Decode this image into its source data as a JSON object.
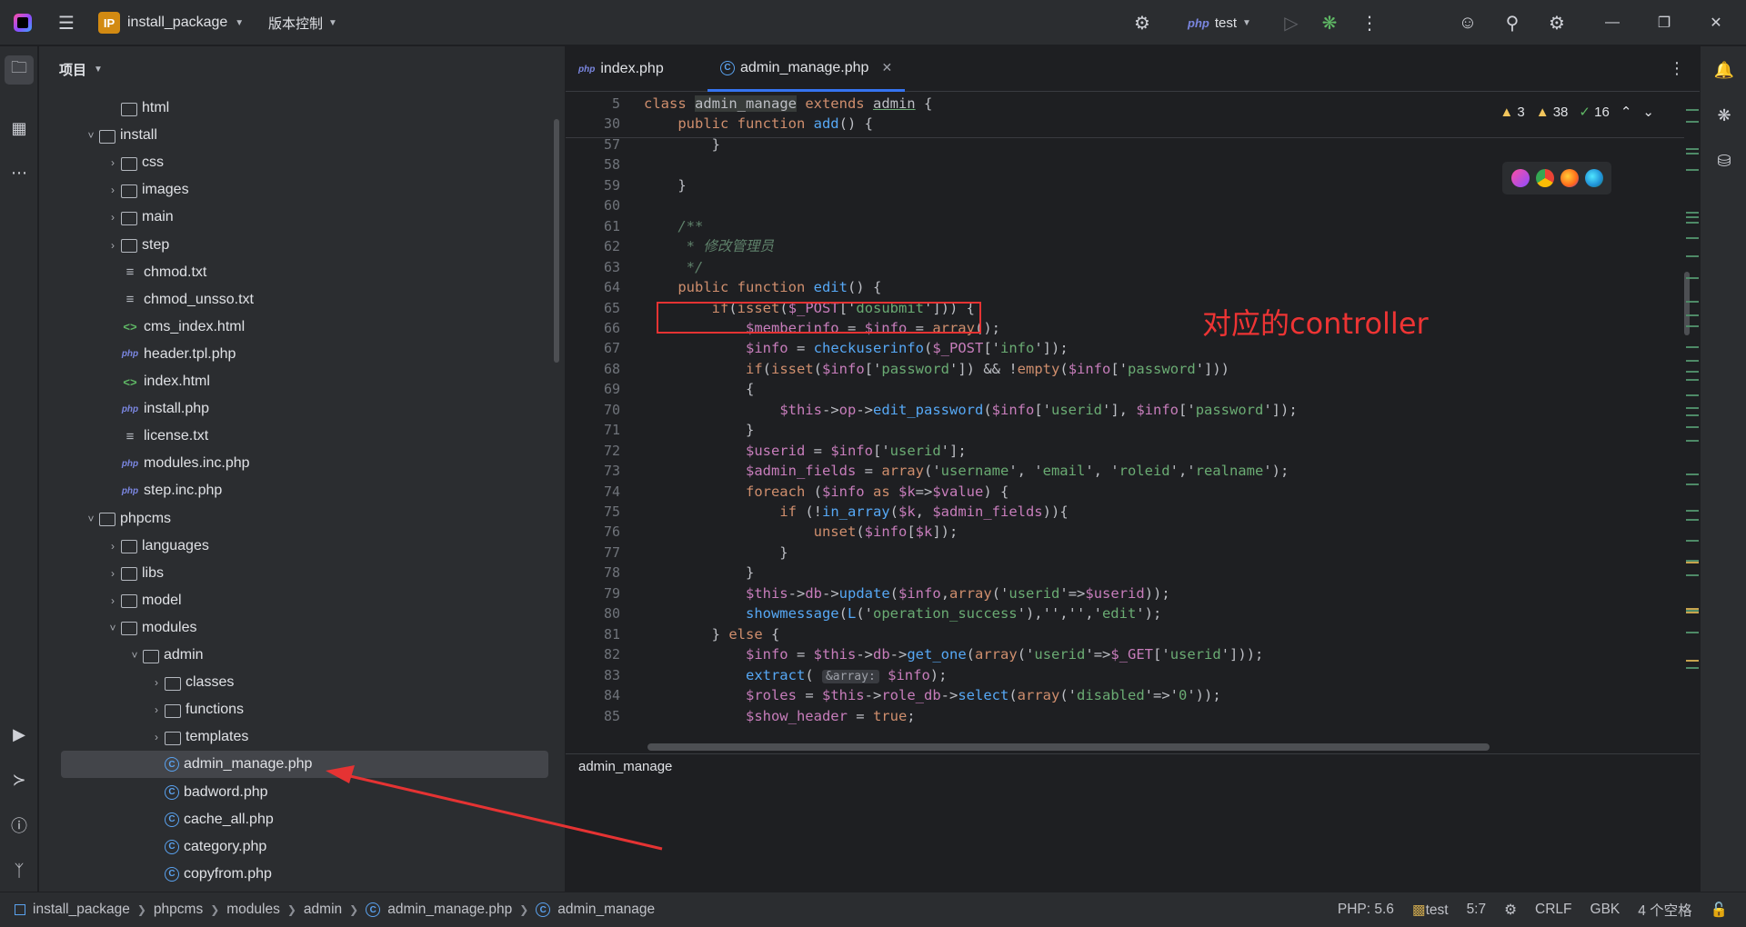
{
  "titlebar": {
    "project_badge": "IP",
    "project_name": "install_package",
    "vcs_label": "版本控制",
    "run_config_lang": "php",
    "run_config": "test"
  },
  "project_panel": {
    "title": "项目"
  },
  "tree": [
    {
      "depth": 2,
      "type": "folder",
      "label": "html",
      "expand": ""
    },
    {
      "depth": 1,
      "type": "folder",
      "label": "install",
      "expand": "open"
    },
    {
      "depth": 2,
      "type": "folder",
      "label": "css",
      "expand": "closed"
    },
    {
      "depth": 2,
      "type": "folder",
      "label": "images",
      "expand": "closed"
    },
    {
      "depth": 2,
      "type": "folder",
      "label": "main",
      "expand": "closed"
    },
    {
      "depth": 2,
      "type": "folder",
      "label": "step",
      "expand": "closed"
    },
    {
      "depth": 2,
      "type": "txt",
      "label": "chmod.txt",
      "expand": ""
    },
    {
      "depth": 2,
      "type": "txt",
      "label": "chmod_unsso.txt",
      "expand": ""
    },
    {
      "depth": 2,
      "type": "html",
      "label": "cms_index.html",
      "expand": ""
    },
    {
      "depth": 2,
      "type": "php",
      "label": "header.tpl.php",
      "expand": ""
    },
    {
      "depth": 2,
      "type": "html",
      "label": "index.html",
      "expand": ""
    },
    {
      "depth": 2,
      "type": "php",
      "label": "install.php",
      "expand": ""
    },
    {
      "depth": 2,
      "type": "txt",
      "label": "license.txt",
      "expand": ""
    },
    {
      "depth": 2,
      "type": "php",
      "label": "modules.inc.php",
      "expand": ""
    },
    {
      "depth": 2,
      "type": "php",
      "label": "step.inc.php",
      "expand": ""
    },
    {
      "depth": 1,
      "type": "folder",
      "label": "phpcms",
      "expand": "open"
    },
    {
      "depth": 2,
      "type": "folder",
      "label": "languages",
      "expand": "closed"
    },
    {
      "depth": 2,
      "type": "folder",
      "label": "libs",
      "expand": "closed"
    },
    {
      "depth": 2,
      "type": "folder",
      "label": "model",
      "expand": "closed"
    },
    {
      "depth": 2,
      "type": "folder",
      "label": "modules",
      "expand": "open"
    },
    {
      "depth": 3,
      "type": "folder",
      "label": "admin",
      "expand": "open"
    },
    {
      "depth": 4,
      "type": "folder",
      "label": "classes",
      "expand": "closed"
    },
    {
      "depth": 4,
      "type": "folder",
      "label": "functions",
      "expand": "closed"
    },
    {
      "depth": 4,
      "type": "folder",
      "label": "templates",
      "expand": "closed"
    },
    {
      "depth": 4,
      "type": "class",
      "label": "admin_manage.php",
      "expand": "",
      "selected": true
    },
    {
      "depth": 4,
      "type": "class",
      "label": "badword.php",
      "expand": ""
    },
    {
      "depth": 4,
      "type": "class",
      "label": "cache_all.php",
      "expand": ""
    },
    {
      "depth": 4,
      "type": "class",
      "label": "category.php",
      "expand": ""
    },
    {
      "depth": 4,
      "type": "class",
      "label": "copyfrom.php",
      "expand": ""
    }
  ],
  "tabs": [
    {
      "label": "index.php",
      "icon": "php",
      "active": false
    },
    {
      "label": "admin_manage.php",
      "icon": "class",
      "active": true
    }
  ],
  "inspection": {
    "warnings_a": "3",
    "warnings_b": "38",
    "ok": "16"
  },
  "browsers": [
    "phpstorm-icon",
    "chrome-icon",
    "firefox-icon",
    "edge-icon"
  ],
  "code_lines": [
    {
      "n": "5",
      "h": [
        [
          "kw",
          "class "
        ],
        [
          "hl",
          "admin_manage"
        ],
        [
          "kw",
          " extends "
        ],
        [
          "und",
          "admin"
        ],
        [
          "",
          " {"
        ]
      ]
    },
    {
      "n": "30",
      "h": [
        [
          "",
          "    "
        ],
        [
          "kw",
          "public function "
        ],
        [
          "fn",
          "add"
        ],
        [
          "",
          "() {"
        ]
      ]
    },
    {
      "n": "57",
      "h": [
        [
          "",
          "        }"
        ]
      ]
    },
    {
      "n": "58",
      "h": [
        [
          "",
          ""
        ]
      ]
    },
    {
      "n": "59",
      "h": [
        [
          "",
          "    }"
        ]
      ]
    },
    {
      "n": "60",
      "h": [
        [
          "",
          ""
        ]
      ]
    },
    {
      "n": "61",
      "h": [
        [
          "",
          "    "
        ],
        [
          "doc",
          "/**"
        ]
      ]
    },
    {
      "n": "62",
      "h": [
        [
          "",
          "     "
        ],
        [
          "doc",
          "* 修改管理员"
        ]
      ]
    },
    {
      "n": "63",
      "h": [
        [
          "",
          "     "
        ],
        [
          "doc",
          "*/"
        ]
      ]
    },
    {
      "n": "64",
      "h": [
        [
          "",
          "    "
        ],
        [
          "kw",
          "public function "
        ],
        [
          "fn",
          "edit"
        ],
        [
          "",
          "() {"
        ]
      ]
    },
    {
      "n": "65",
      "h": [
        [
          "",
          "        "
        ],
        [
          "kw",
          "if"
        ],
        [
          "",
          "("
        ],
        [
          "kw",
          "isset"
        ],
        [
          "",
          "("
        ],
        [
          "var",
          "$_POST"
        ],
        [
          "",
          "['"
        ],
        [
          "str",
          "dosubmit"
        ],
        [
          "",
          "'])) {"
        ]
      ]
    },
    {
      "n": "66",
      "h": [
        [
          "",
          "            "
        ],
        [
          "var",
          "$memberinfo"
        ],
        [
          "",
          " = "
        ],
        [
          "var",
          "$info"
        ],
        [
          "",
          " = "
        ],
        [
          "kw",
          "array"
        ],
        [
          "",
          "();"
        ]
      ]
    },
    {
      "n": "67",
      "h": [
        [
          "",
          "            "
        ],
        [
          "var",
          "$info"
        ],
        [
          "",
          " = "
        ],
        [
          "fn",
          "checkuserinfo"
        ],
        [
          "",
          "("
        ],
        [
          "var",
          "$_POST"
        ],
        [
          "",
          "['"
        ],
        [
          "str",
          "info"
        ],
        [
          "",
          "']);"
        ]
      ]
    },
    {
      "n": "68",
      "h": [
        [
          "",
          "            "
        ],
        [
          "kw",
          "if"
        ],
        [
          "",
          "("
        ],
        [
          "kw",
          "isset"
        ],
        [
          "",
          "("
        ],
        [
          "var",
          "$info"
        ],
        [
          "",
          "['"
        ],
        [
          "str",
          "password"
        ],
        [
          "",
          "']) && !"
        ],
        [
          "kw",
          "empty"
        ],
        [
          "",
          "("
        ],
        [
          "var",
          "$info"
        ],
        [
          "",
          "['"
        ],
        [
          "str",
          "password"
        ],
        [
          "",
          "']))"
        ]
      ]
    },
    {
      "n": "69",
      "h": [
        [
          "",
          "            {"
        ]
      ]
    },
    {
      "n": "70",
      "h": [
        [
          "",
          "                "
        ],
        [
          "var",
          "$this"
        ],
        [
          "",
          "->"
        ],
        [
          "var",
          "op"
        ],
        [
          "",
          "->"
        ],
        [
          "fn",
          "edit_password"
        ],
        [
          "",
          "("
        ],
        [
          "var",
          "$info"
        ],
        [
          "",
          "['"
        ],
        [
          "str",
          "userid"
        ],
        [
          "",
          "'], "
        ],
        [
          "var",
          "$info"
        ],
        [
          "",
          "['"
        ],
        [
          "str",
          "password"
        ],
        [
          "",
          "']);"
        ]
      ]
    },
    {
      "n": "71",
      "h": [
        [
          "",
          "            }"
        ]
      ]
    },
    {
      "n": "72",
      "h": [
        [
          "",
          "            "
        ],
        [
          "var",
          "$userid"
        ],
        [
          "",
          " = "
        ],
        [
          "var",
          "$info"
        ],
        [
          "",
          "['"
        ],
        [
          "str",
          "userid"
        ],
        [
          "",
          "'];"
        ]
      ]
    },
    {
      "n": "73",
      "h": [
        [
          "",
          "            "
        ],
        [
          "var",
          "$admin_fields"
        ],
        [
          "",
          " = "
        ],
        [
          "kw",
          "array"
        ],
        [
          "",
          "('"
        ],
        [
          "str",
          "username"
        ],
        [
          "",
          "', '"
        ],
        [
          "str",
          "email"
        ],
        [
          "",
          "', '"
        ],
        [
          "str",
          "roleid"
        ],
        [
          "",
          "','"
        ],
        [
          "str",
          "realname"
        ],
        [
          "",
          "');"
        ]
      ]
    },
    {
      "n": "74",
      "h": [
        [
          "",
          "            "
        ],
        [
          "kw",
          "foreach "
        ],
        [
          "",
          "("
        ],
        [
          "var",
          "$info"
        ],
        [
          "kw",
          " as "
        ],
        [
          "var",
          "$k"
        ],
        [
          "",
          "=>"
        ],
        [
          "var",
          "$value"
        ],
        [
          "",
          ") {"
        ]
      ]
    },
    {
      "n": "75",
      "h": [
        [
          "",
          "                "
        ],
        [
          "kw",
          "if "
        ],
        [
          "",
          "(!"
        ],
        [
          "fn",
          "in_array"
        ],
        [
          "",
          "("
        ],
        [
          "var",
          "$k"
        ],
        [
          "",
          ", "
        ],
        [
          "var",
          "$admin_fields"
        ],
        [
          "",
          ")){"
        ]
      ]
    },
    {
      "n": "76",
      "h": [
        [
          "",
          "                    "
        ],
        [
          "kw",
          "unset"
        ],
        [
          "",
          "("
        ],
        [
          "var",
          "$info"
        ],
        [
          "",
          "["
        ],
        [
          "var",
          "$k"
        ],
        [
          "",
          "]);"
        ]
      ]
    },
    {
      "n": "77",
      "h": [
        [
          "",
          "                }"
        ]
      ]
    },
    {
      "n": "78",
      "h": [
        [
          "",
          "            }"
        ]
      ]
    },
    {
      "n": "79",
      "h": [
        [
          "",
          "            "
        ],
        [
          "var",
          "$this"
        ],
        [
          "",
          "->"
        ],
        [
          "var",
          "db"
        ],
        [
          "",
          "->"
        ],
        [
          "fn",
          "update"
        ],
        [
          "",
          "("
        ],
        [
          "var",
          "$info"
        ],
        [
          "",
          ","
        ],
        [
          "kw",
          "array"
        ],
        [
          "",
          "('"
        ],
        [
          "str",
          "userid"
        ],
        [
          "",
          "'=>"
        ],
        [
          "var",
          "$userid"
        ],
        [
          "",
          "));"
        ]
      ]
    },
    {
      "n": "80",
      "h": [
        [
          "",
          "            "
        ],
        [
          "fn",
          "showmessage"
        ],
        [
          "",
          "("
        ],
        [
          "fn",
          "L"
        ],
        [
          "",
          "('"
        ],
        [
          "str",
          "operation_success"
        ],
        [
          "",
          "'),'','','"
        ],
        [
          "str",
          "edit"
        ],
        [
          "",
          "');"
        ]
      ]
    },
    {
      "n": "81",
      "h": [
        [
          "",
          "        } "
        ],
        [
          "kw",
          "else"
        ],
        [
          "",
          " {"
        ]
      ]
    },
    {
      "n": "82",
      "h": [
        [
          "",
          "            "
        ],
        [
          "var",
          "$info"
        ],
        [
          "",
          " = "
        ],
        [
          "var",
          "$this"
        ],
        [
          "",
          "->"
        ],
        [
          "var",
          "db"
        ],
        [
          "",
          "->"
        ],
        [
          "fn",
          "get_one"
        ],
        [
          "",
          "("
        ],
        [
          "kw",
          "array"
        ],
        [
          "",
          "('"
        ],
        [
          "str",
          "userid"
        ],
        [
          "",
          "'=>"
        ],
        [
          "var",
          "$_GET"
        ],
        [
          "",
          "['"
        ],
        [
          "str",
          "userid"
        ],
        [
          "",
          "']));"
        ]
      ]
    },
    {
      "n": "83",
      "h": [
        [
          "",
          "            "
        ],
        [
          "fn",
          "extract"
        ],
        [
          "",
          "( "
        ],
        [
          "hint",
          "&array:"
        ],
        [
          "",
          " "
        ],
        [
          "var",
          "$info"
        ],
        [
          "",
          ");"
        ]
      ]
    },
    {
      "n": "84",
      "h": [
        [
          "",
          "            "
        ],
        [
          "var",
          "$roles"
        ],
        [
          "",
          " = "
        ],
        [
          "var",
          "$this"
        ],
        [
          "",
          "->"
        ],
        [
          "var",
          "role_db"
        ],
        [
          "",
          "->"
        ],
        [
          "fn",
          "select"
        ],
        [
          "",
          "("
        ],
        [
          "kw",
          "array"
        ],
        [
          "",
          "('"
        ],
        [
          "str",
          "disabled"
        ],
        [
          "",
          "'=>'"
        ],
        [
          "str",
          "0"
        ],
        [
          "",
          "'));"
        ]
      ]
    },
    {
      "n": "85",
      "h": [
        [
          "",
          "            "
        ],
        [
          "var",
          "$show_header"
        ],
        [
          "",
          " = "
        ],
        [
          "kw",
          "true"
        ],
        [
          "",
          ";"
        ]
      ]
    }
  ],
  "annotation": {
    "label": "对应的controller"
  },
  "editor_breadcrumb": "admin_manage",
  "status": {
    "crumbs": [
      "install_package",
      "phpcms",
      "modules",
      "admin",
      "admin_manage.php",
      "admin_manage"
    ],
    "php_version": "PHP: 5.6",
    "interpreter": "test",
    "position": "5:7",
    "line_sep": "CRLF",
    "encoding": "GBK",
    "indent": "4 个空格"
  }
}
